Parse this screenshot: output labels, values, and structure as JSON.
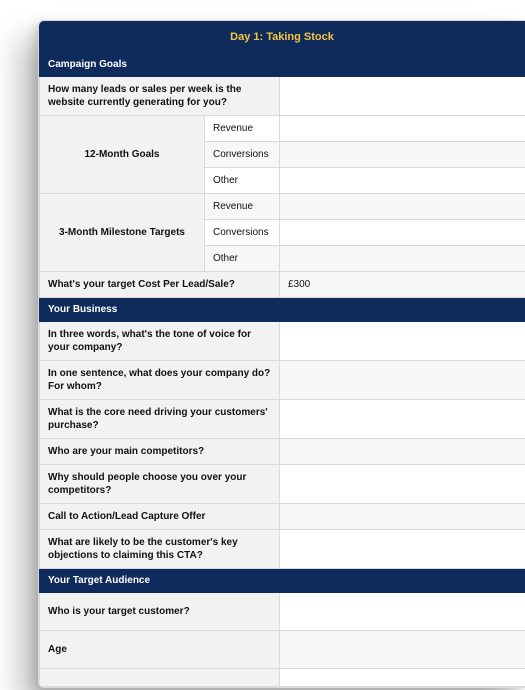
{
  "title": "Day 1: Taking Stock",
  "sections": {
    "campaign_goals": {
      "heading": "Campaign Goals",
      "q_leads": "How many leads or sales per week is the website currently generating for you?",
      "q_12month": "12-Month Goals",
      "q_3month": "3-Month Milestone Targets",
      "sub_revenue": "Revenue",
      "sub_conversions": "Conversions",
      "sub_other": "Other",
      "q_target_cost": "What's your target Cost Per Lead/Sale?",
      "v_target_cost": "£300"
    },
    "your_business": {
      "heading": "Your Business",
      "q_tone": "In three words, what's the tone of voice for your company?",
      "q_sentence": "In one sentence, what does your company do? For whom?",
      "q_core_need": "What is the core need driving your customers' purchase?",
      "q_competitors": "Who are your main competitors?",
      "q_why_choose": "Why should people choose you over your competitors?",
      "q_cta": "Call to Action/Lead Capture Offer",
      "q_objections": "What are likely to be the customer's key objections to claiming this CTA?"
    },
    "target_audience": {
      "heading": "Your Target Audience",
      "q_who": "Who is your target customer?",
      "q_age": "Age"
    }
  }
}
